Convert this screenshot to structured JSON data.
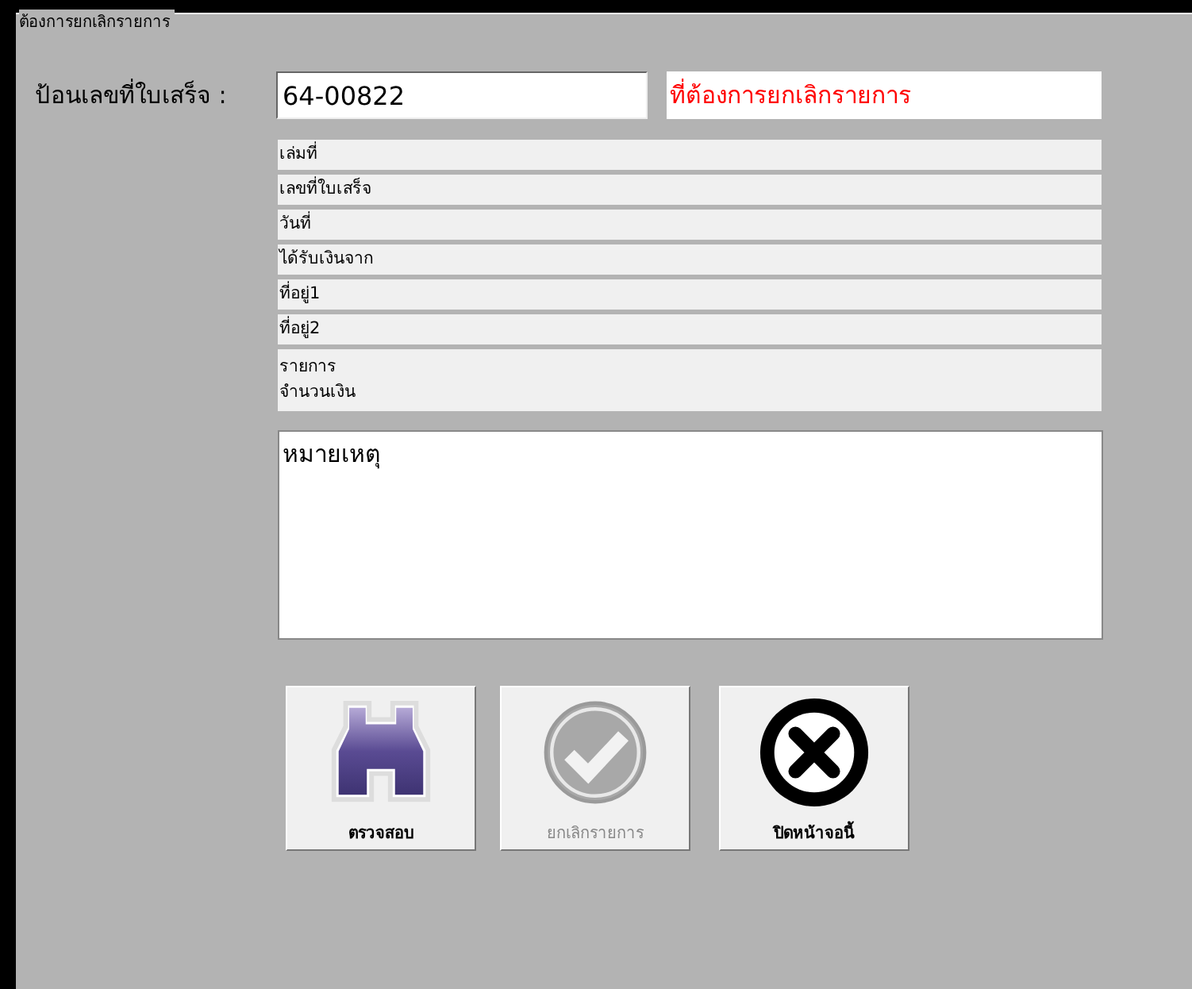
{
  "group_title": "ต้องการยกเลิกรายการ",
  "receipt_field": {
    "label": "ป้อนเลขที่ใบเสร็จ :",
    "value": "64-00822",
    "hint": "ที่ต้องการยกเลิกรายการ"
  },
  "info_rows": [
    {
      "lines": [
        "เล่มที่"
      ]
    },
    {
      "lines": [
        "เลขที่ใบเสร็จ"
      ]
    },
    {
      "lines": [
        "วันที่"
      ]
    },
    {
      "lines": [
        "ได้รับเงินจาก"
      ]
    },
    {
      "lines": [
        "ที่อยู่1"
      ]
    },
    {
      "lines": [
        "ที่อยู่2"
      ]
    },
    {
      "lines": [
        "รายการ",
        "จำนวนเงิน"
      ]
    }
  ],
  "remarks": {
    "value": "หมายเหตุ"
  },
  "buttons": [
    {
      "kind": "search",
      "label": "ตรวจสอบ",
      "disabled": false
    },
    {
      "kind": "confirm",
      "label": "ยกเลิกรายการ",
      "disabled": true
    },
    {
      "kind": "close",
      "label": "ปิดหน้าจอนี้",
      "disabled": false
    }
  ]
}
